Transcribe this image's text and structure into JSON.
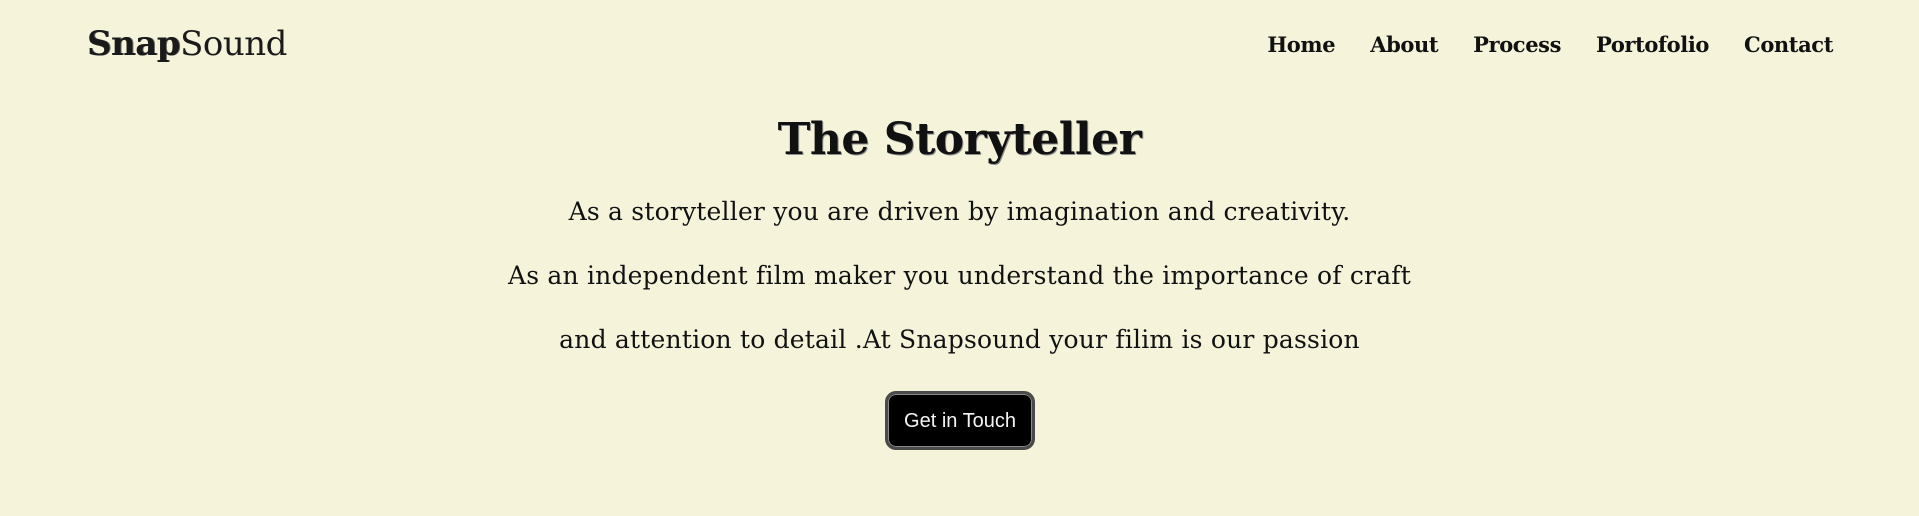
{
  "brand": {
    "name_part1": "Snap",
    "name_part2": "Sound"
  },
  "nav": {
    "items": [
      {
        "label": "Home"
      },
      {
        "label": "About"
      },
      {
        "label": "Process"
      },
      {
        "label": "Portofolio"
      },
      {
        "label": "Contact"
      }
    ]
  },
  "hero": {
    "title": "The Storyteller",
    "lines": [
      "As a storyteller you are driven by imagination and creativity.",
      "As an independent film maker you understand the importance of craft",
      "and attention to detail .At Snapsound your filim is our passion"
    ],
    "cta_label": "Get in Touch"
  },
  "colors": {
    "background": "#f5f4da",
    "text": "#111111",
    "button": "#000000",
    "button_text": "#f4f4f4"
  }
}
